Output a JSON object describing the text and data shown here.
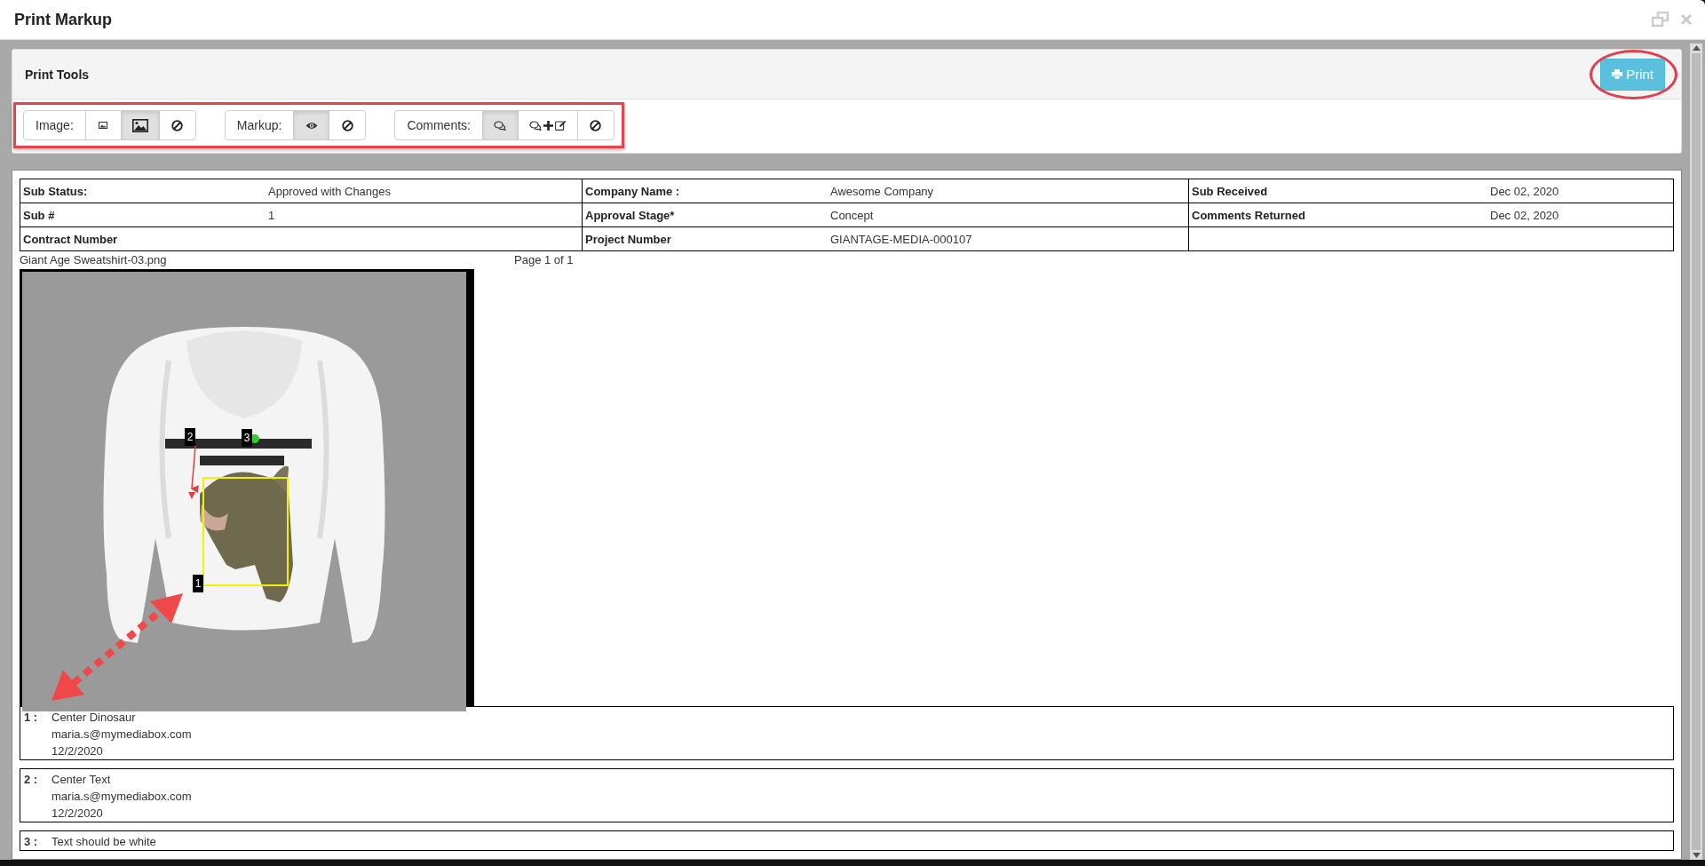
{
  "window": {
    "title": "Print Markup"
  },
  "panel": {
    "title": "Print Tools",
    "print_button": "Print"
  },
  "toolbar": [
    {
      "label": "Image:",
      "options": [
        {
          "kind": "image-small",
          "selected": false
        },
        {
          "kind": "image-large",
          "selected": true
        },
        {
          "kind": "none",
          "selected": false
        }
      ]
    },
    {
      "label": "Markup:",
      "options": [
        {
          "kind": "eye",
          "selected": true
        },
        {
          "kind": "none",
          "selected": false
        }
      ]
    },
    {
      "label": "Comments:",
      "options": [
        {
          "kind": "comments",
          "selected": true
        },
        {
          "kind": "comments-add-edit",
          "selected": false
        },
        {
          "kind": "none",
          "selected": false
        }
      ]
    }
  ],
  "info_table": {
    "rows": [
      [
        {
          "label": "Sub Status:",
          "value": "Approved with Changes"
        },
        {
          "label": "Company Name :",
          "value": "Awesome Company"
        },
        {
          "label": "Sub Received",
          "value": "Dec 02, 2020"
        }
      ],
      [
        {
          "label": "Sub #",
          "value": "1"
        },
        {
          "label": "Approval Stage*",
          "value": "Concept"
        },
        {
          "label": "Comments Returned",
          "value": "Dec 02, 2020"
        }
      ],
      [
        {
          "label": "Contract Number"
        },
        {
          "label": "Project Number",
          "value": "GIANTAGE-MEDIA-000107"
        },
        {}
      ]
    ]
  },
  "file_name": "Giant Age Sweatshirt-03.png",
  "page_label": "Page 1 of 1",
  "image": {
    "kind": "picture",
    "markers": [
      "1",
      "2",
      "3"
    ]
  },
  "comments": [
    {
      "number": "1 :",
      "text": "Center Dinosaur",
      "author": "maria.s@mymediabox.com",
      "date": "12/2/2020"
    },
    {
      "number": "2 :",
      "text": "Center Text",
      "author": "maria.s@mymediabox.com",
      "date": "12/2/2020"
    },
    {
      "number": "3 :",
      "text": "Text should be white"
    }
  ]
}
